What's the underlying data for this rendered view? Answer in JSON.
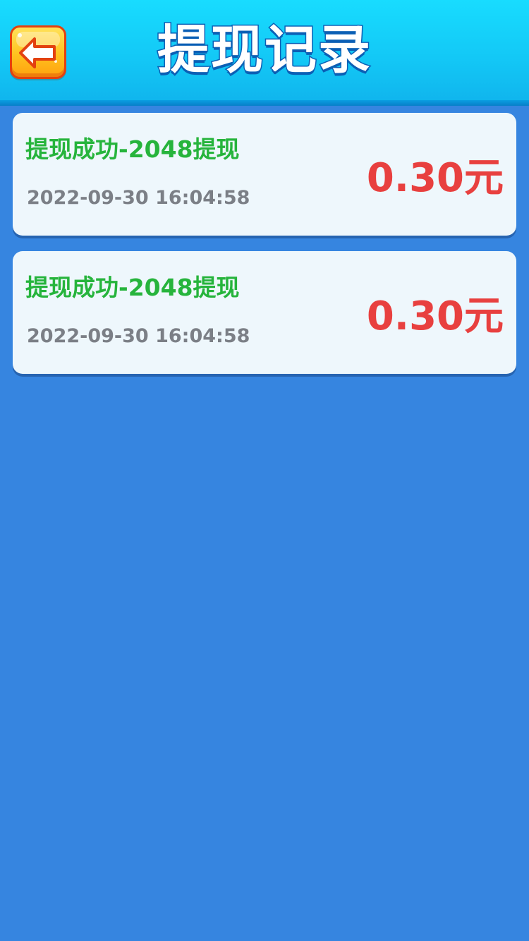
{
  "header": {
    "title": "提现记录",
    "back_icon": "arrow-left-icon"
  },
  "records": [
    {
      "title": "提现成功-2048提现",
      "time": "2022-09-30 16:04:58",
      "amount": "0.30元"
    },
    {
      "title": "提现成功-2048提现",
      "time": "2022-09-30 16:04:58",
      "amount": "0.30元"
    }
  ],
  "colors": {
    "header": "#13c8f6",
    "background": "#3685e0",
    "card": "#eef7fc",
    "title_green": "#26b43c",
    "amount_red": "#e8403f",
    "time_gray": "#7b7f86"
  }
}
